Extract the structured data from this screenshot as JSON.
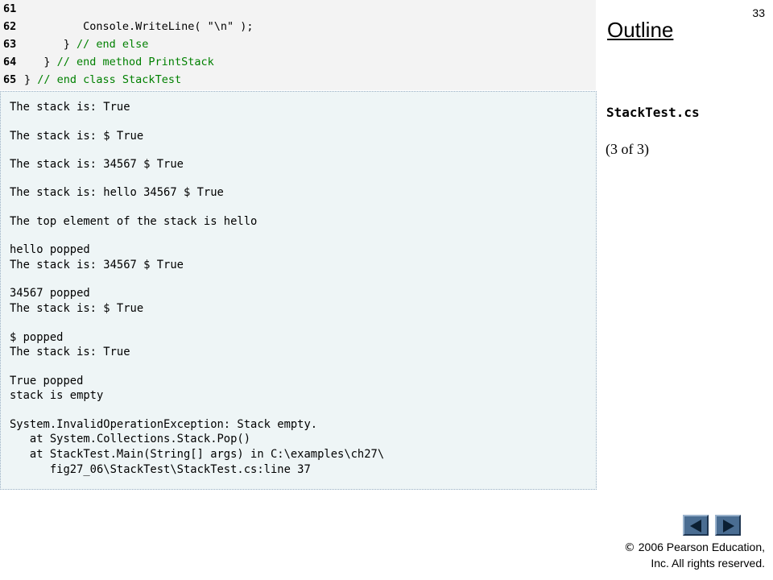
{
  "slide": {
    "page_number": "33",
    "outline_label": "Outline",
    "file_name": "StackTest.cs",
    "part_label": "(3 of 3)"
  },
  "code": {
    "lines": [
      {
        "num": "61",
        "code": "",
        "comment": ""
      },
      {
        "num": "62",
        "code": "         Console.WriteLine( \"\\n\" );",
        "comment": ""
      },
      {
        "num": "63",
        "code": "      } ",
        "comment": "// end else"
      },
      {
        "num": "64",
        "code": "   } ",
        "comment": "// end method PrintStack"
      },
      {
        "num": "65",
        "code": "} ",
        "comment": "// end class StackTest"
      }
    ]
  },
  "output": {
    "lines": [
      "The stack is: True",
      "The stack is: $ True",
      "The stack is: 34567 $ True",
      "The stack is: hello 34567 $ True",
      "The top element of the stack is hello",
      "hello popped",
      "The stack is: 34567 $ True",
      "34567 popped",
      "The stack is: $ True",
      "$ popped",
      "The stack is: True",
      "True popped",
      "stack is empty",
      "System.InvalidOperationException: Stack empty.",
      "   at System.Collections.Stack.Pop()",
      "   at StackTest.Main(String[] args) in C:\\examples\\ch27\\",
      "      fig27_06\\StackTest\\StackTest.cs:line 37"
    ]
  },
  "navigation": {
    "prev_icon": "triangle-left-icon",
    "next_icon": "triangle-right-icon"
  },
  "footer": {
    "copyright_symbol": "©",
    "copyright_line1": " 2006 Pearson Education,",
    "copyright_line2": "Inc.  All rights reserved."
  },
  "colors": {
    "code_background": "#f3f3f3",
    "comment_green": "#008000",
    "output_background": "#eef5f6",
    "nav_button": "#4a6d92"
  }
}
